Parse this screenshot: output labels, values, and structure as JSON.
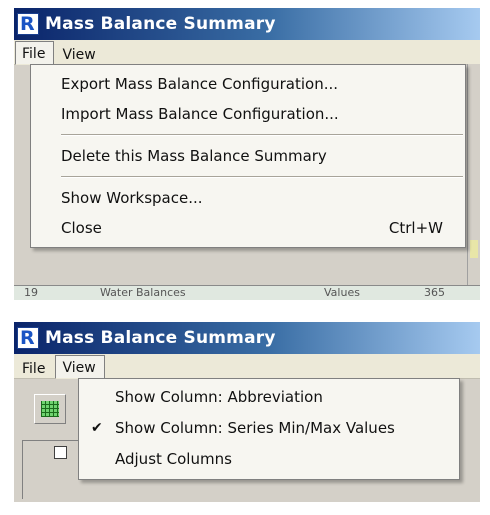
{
  "window_title": "Mass Balance Summary",
  "app_icon_letter": "R",
  "menubar": {
    "file_label": "File",
    "view_label": "View"
  },
  "file_menu": {
    "items": [
      {
        "label": "Export Mass Balance Configuration..."
      },
      {
        "label": "Import Mass Balance Configuration..."
      },
      {
        "label": "Delete this Mass Balance Summary"
      },
      {
        "label": "Show Workspace..."
      },
      {
        "label": "Close",
        "shortcut": "Ctrl+W"
      }
    ]
  },
  "view_menu": {
    "check_glyph": "✔",
    "items": [
      {
        "label": "Show Column: Abbreviation",
        "checked": false
      },
      {
        "label": "Show Column: Series Min/Max Values",
        "checked": true
      },
      {
        "label": "Adjust Columns",
        "checked": false
      }
    ]
  },
  "background": {
    "row_number": "19",
    "row_name": "Water Balances",
    "row_value": "Values",
    "row_extra": "365"
  },
  "colors": {
    "title_gradient_start": "#0a246a",
    "title_gradient_end": "#a6caf0",
    "menubar": "#ece9d8",
    "menu_bg": "#f7f6f1"
  }
}
